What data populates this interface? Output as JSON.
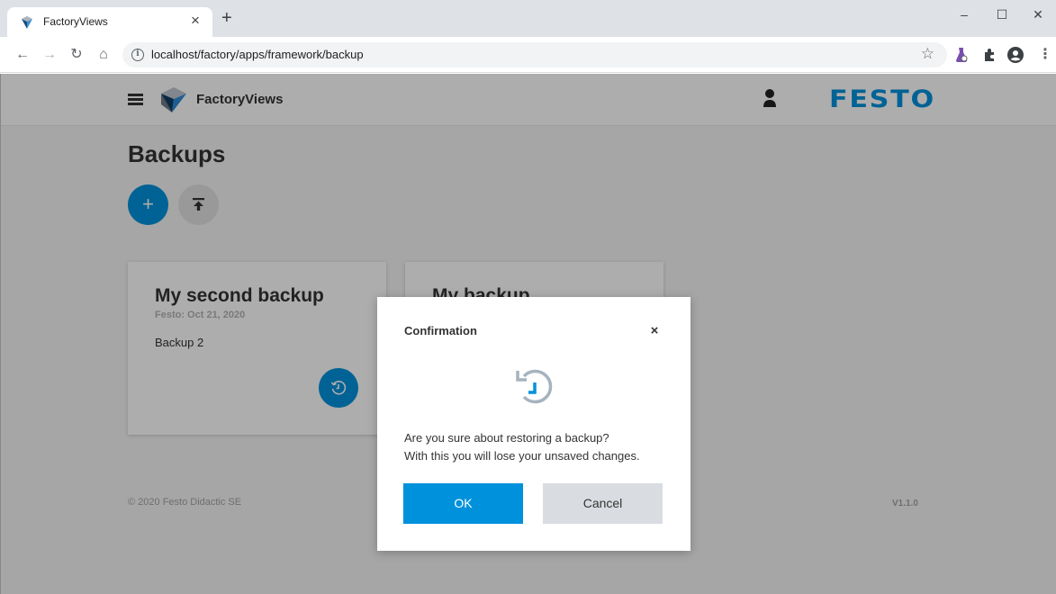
{
  "browser": {
    "tab_title": "FactoryViews",
    "tab_close": "×",
    "new_tab": "+",
    "url": "localhost/factory/apps/framework/backup",
    "window_controls": {
      "minimize": "–",
      "maximize": "☐",
      "close": "✕"
    }
  },
  "header": {
    "app_name": "FactoryViews",
    "brand": "FESTO"
  },
  "page": {
    "title": "Backups",
    "add_button_label": "+"
  },
  "cards": [
    {
      "title": "My second backup",
      "subtitle": "Festo: Oct 21, 2020",
      "description": "Backup 2"
    },
    {
      "title": "My backup"
    }
  ],
  "footer": {
    "copyright": "© 2020 Festo Didactic SE",
    "version": "V1.1.0"
  },
  "modal": {
    "title": "Confirmation",
    "close_label": "×",
    "line1": "Are you sure about restoring a backup?",
    "line2": "With this you will lose your unsaved changes.",
    "ok_label": "OK",
    "cancel_label": "Cancel"
  },
  "colors": {
    "brand_blue": "#0091dc",
    "overlay": "rgba(0,0,0,0.32)",
    "cancel_bg": "#d9dde1"
  },
  "icons": {
    "menu": "hamburger-icon",
    "user": "user-icon",
    "add": "plus-icon",
    "upload": "upload-icon",
    "restore": "history-icon",
    "close": "close-icon"
  }
}
